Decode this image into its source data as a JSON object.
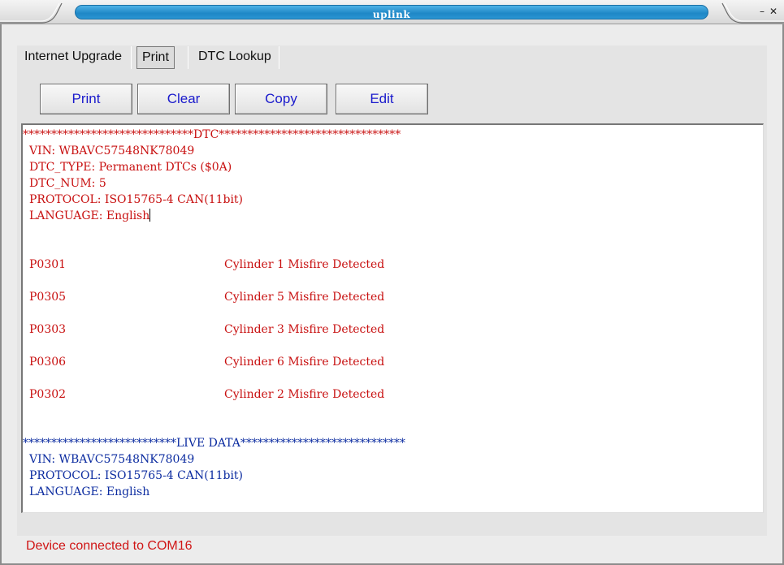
{
  "window": {
    "title": "uplink",
    "minimize_label": "–",
    "close_label": "✕"
  },
  "tabs": [
    {
      "label": "Internet Upgrade"
    },
    {
      "label": "Print"
    },
    {
      "label": "DTC Lookup"
    }
  ],
  "toolbar": {
    "print_label": "Print",
    "clear_label": "Clear",
    "copy_label": "Copy",
    "edit_label": "Edit"
  },
  "report": {
    "dtc_header": "******************************DTC********************************",
    "vin": "VIN: WBAVC57548NK78049",
    "dtc_type": "DTC_TYPE: Permanent DTCs ($0A)",
    "dtc_num": "DTC_NUM: 5",
    "protocol": "PROTOCOL: ISO15765-4 CAN(11bit)",
    "language": "LANGUAGE: English",
    "dtcs": [
      {
        "code": "P0301",
        "desc": "Cylinder 1 Misfire Detected"
      },
      {
        "code": "P0305",
        "desc": "Cylinder 5 Misfire Detected"
      },
      {
        "code": "P0303",
        "desc": "Cylinder 3 Misfire Detected"
      },
      {
        "code": "P0306",
        "desc": "Cylinder 6 Misfire Detected"
      },
      {
        "code": "P0302",
        "desc": "Cylinder 2 Misfire Detected"
      }
    ],
    "live_header": "***************************LIVE DATA*****************************",
    "live_vin": "VIN: WBAVC57548NK78049",
    "live_protocol": "PROTOCOL: ISO15765-4 CAN(11bit)",
    "live_language": "LANGUAGE: English"
  },
  "status": {
    "text": "Device connected to COM16",
    "color": "#d01616"
  },
  "colors": {
    "accent": "#1e87c6",
    "dtc_text": "#c81010",
    "live_text": "#0c2ca0",
    "button_text": "#1a1acc"
  }
}
